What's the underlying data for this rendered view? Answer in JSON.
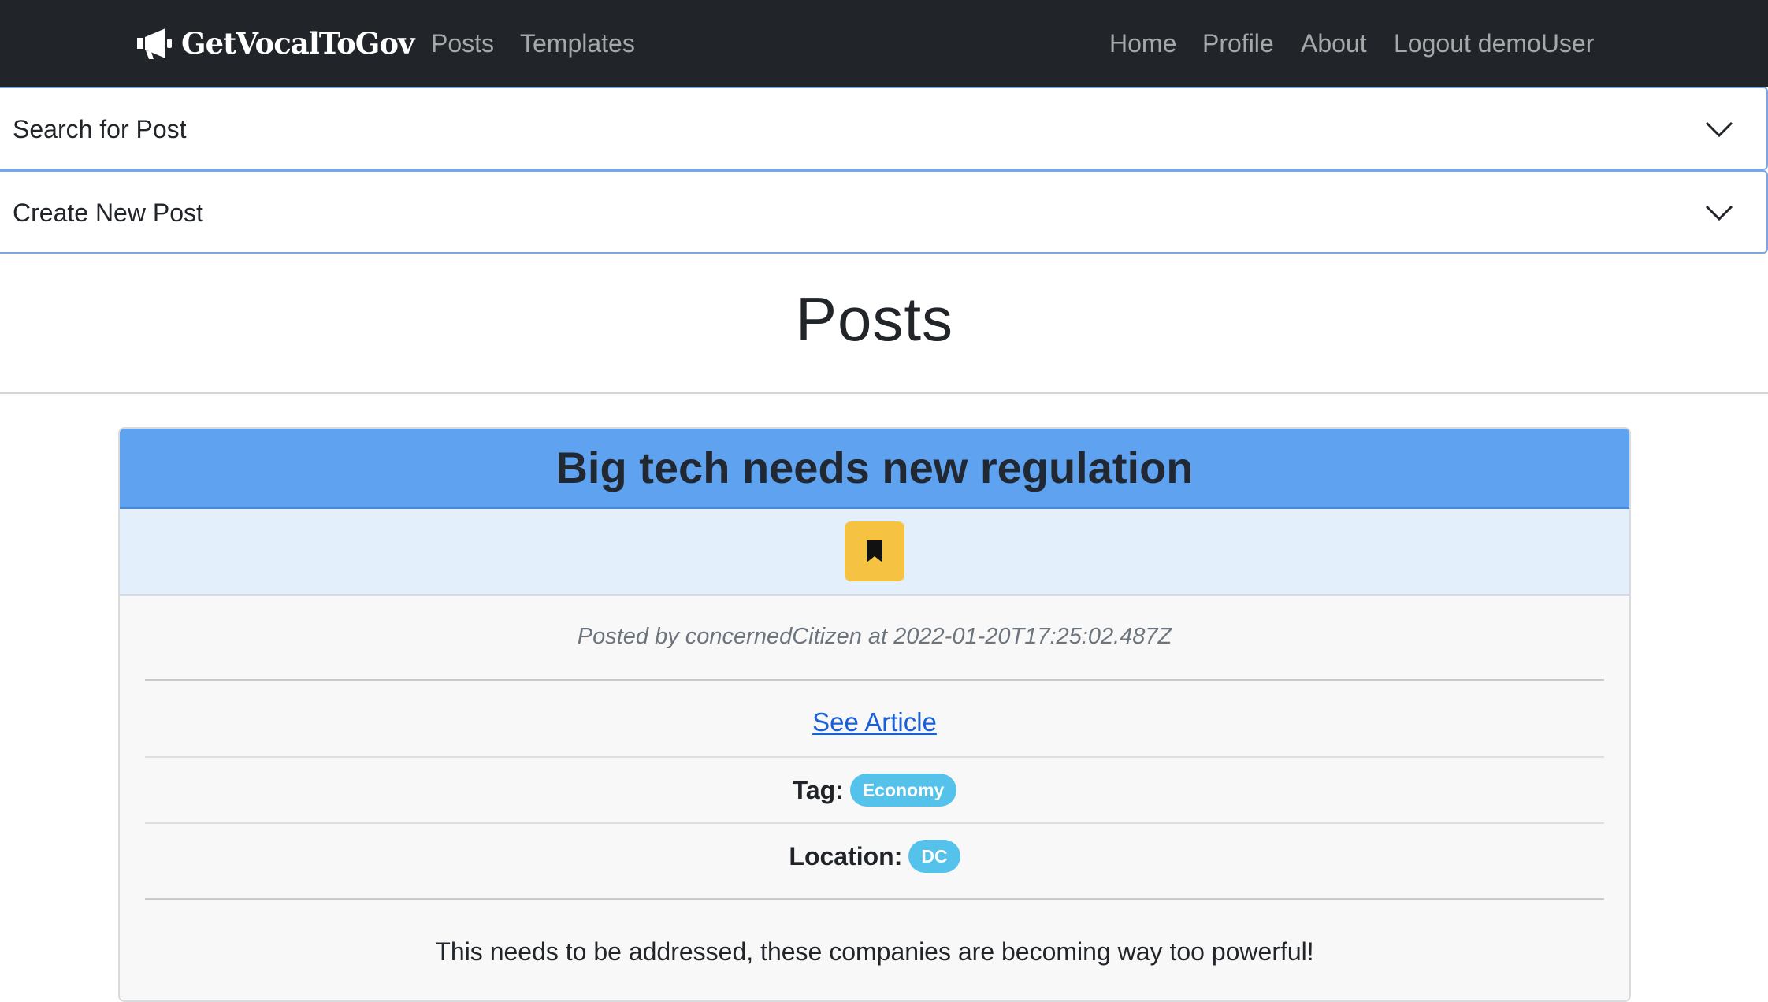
{
  "navbar": {
    "brand": "GetVocalToGov",
    "left_links": [
      "Posts",
      "Templates"
    ],
    "right_links": [
      "Home",
      "Profile",
      "About",
      "Logout demoUser"
    ]
  },
  "accordions": {
    "search": "Search for Post",
    "create": "Create New Post"
  },
  "page": {
    "title": "Posts"
  },
  "post": {
    "title": "Big tech needs new regulation",
    "bookmark_icon": "bookmark-icon",
    "meta": "Posted by concernedCitizen at 2022-01-20T17:25:02.487Z",
    "article_link": "See Article",
    "tag_label": "Tag:",
    "tag": "Economy",
    "location_label": "Location:",
    "location": "DC",
    "body": "This needs to be addressed, these companies are becoming way too powerful!"
  },
  "colors": {
    "navbar_bg": "#212529",
    "card_header": "#5ea2f0",
    "bookmark_button": "#f5c242",
    "pill": "#54c2ea",
    "link": "#1a5fd6"
  }
}
